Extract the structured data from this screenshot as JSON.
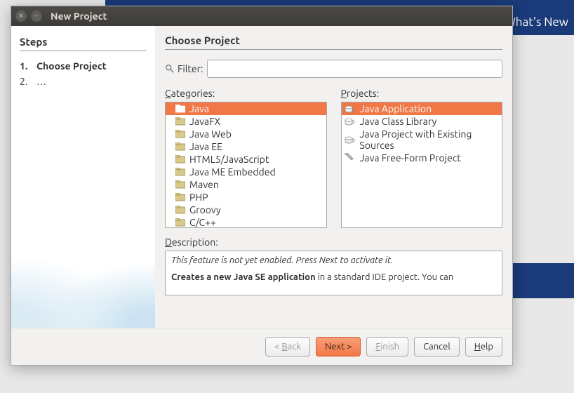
{
  "window": {
    "title": "New Project"
  },
  "backdrop": {
    "whats_new": "What's New"
  },
  "steps": {
    "title": "Steps",
    "items": [
      {
        "num": "1.",
        "label": "Choose Project",
        "current": true
      },
      {
        "num": "2.",
        "label": "…",
        "current": false
      }
    ]
  },
  "main": {
    "title": "Choose Project",
    "filter_label": "Filter:",
    "filter_value": "",
    "categories_label": "Categories:",
    "projects_label": "Projects:",
    "categories": [
      {
        "label": "Java",
        "selected": true
      },
      {
        "label": "JavaFX"
      },
      {
        "label": "Java Web"
      },
      {
        "label": "Java EE"
      },
      {
        "label": "HTML5/JavaScript"
      },
      {
        "label": "Java ME Embedded"
      },
      {
        "label": "Maven"
      },
      {
        "label": "PHP"
      },
      {
        "label": "Groovy"
      },
      {
        "label": "C/C++"
      }
    ],
    "projects": [
      {
        "label": "Java Application",
        "selected": true,
        "icon": "cup"
      },
      {
        "label": "Java Class Library",
        "icon": "cup"
      },
      {
        "label": "Java Project with Existing Sources",
        "icon": "cup"
      },
      {
        "label": "Java Free-Form Project",
        "icon": "wrench"
      }
    ],
    "description_label": "Description:",
    "description_line1": "This feature is not yet enabled. Press Next to activate it.",
    "description_bold": "Creates a new Java SE application",
    "description_rest": " in a standard IDE project. You can"
  },
  "buttons": {
    "back": "< Back",
    "next": "Next >",
    "finish": "Finish",
    "cancel": "Cancel",
    "help": "Help"
  }
}
